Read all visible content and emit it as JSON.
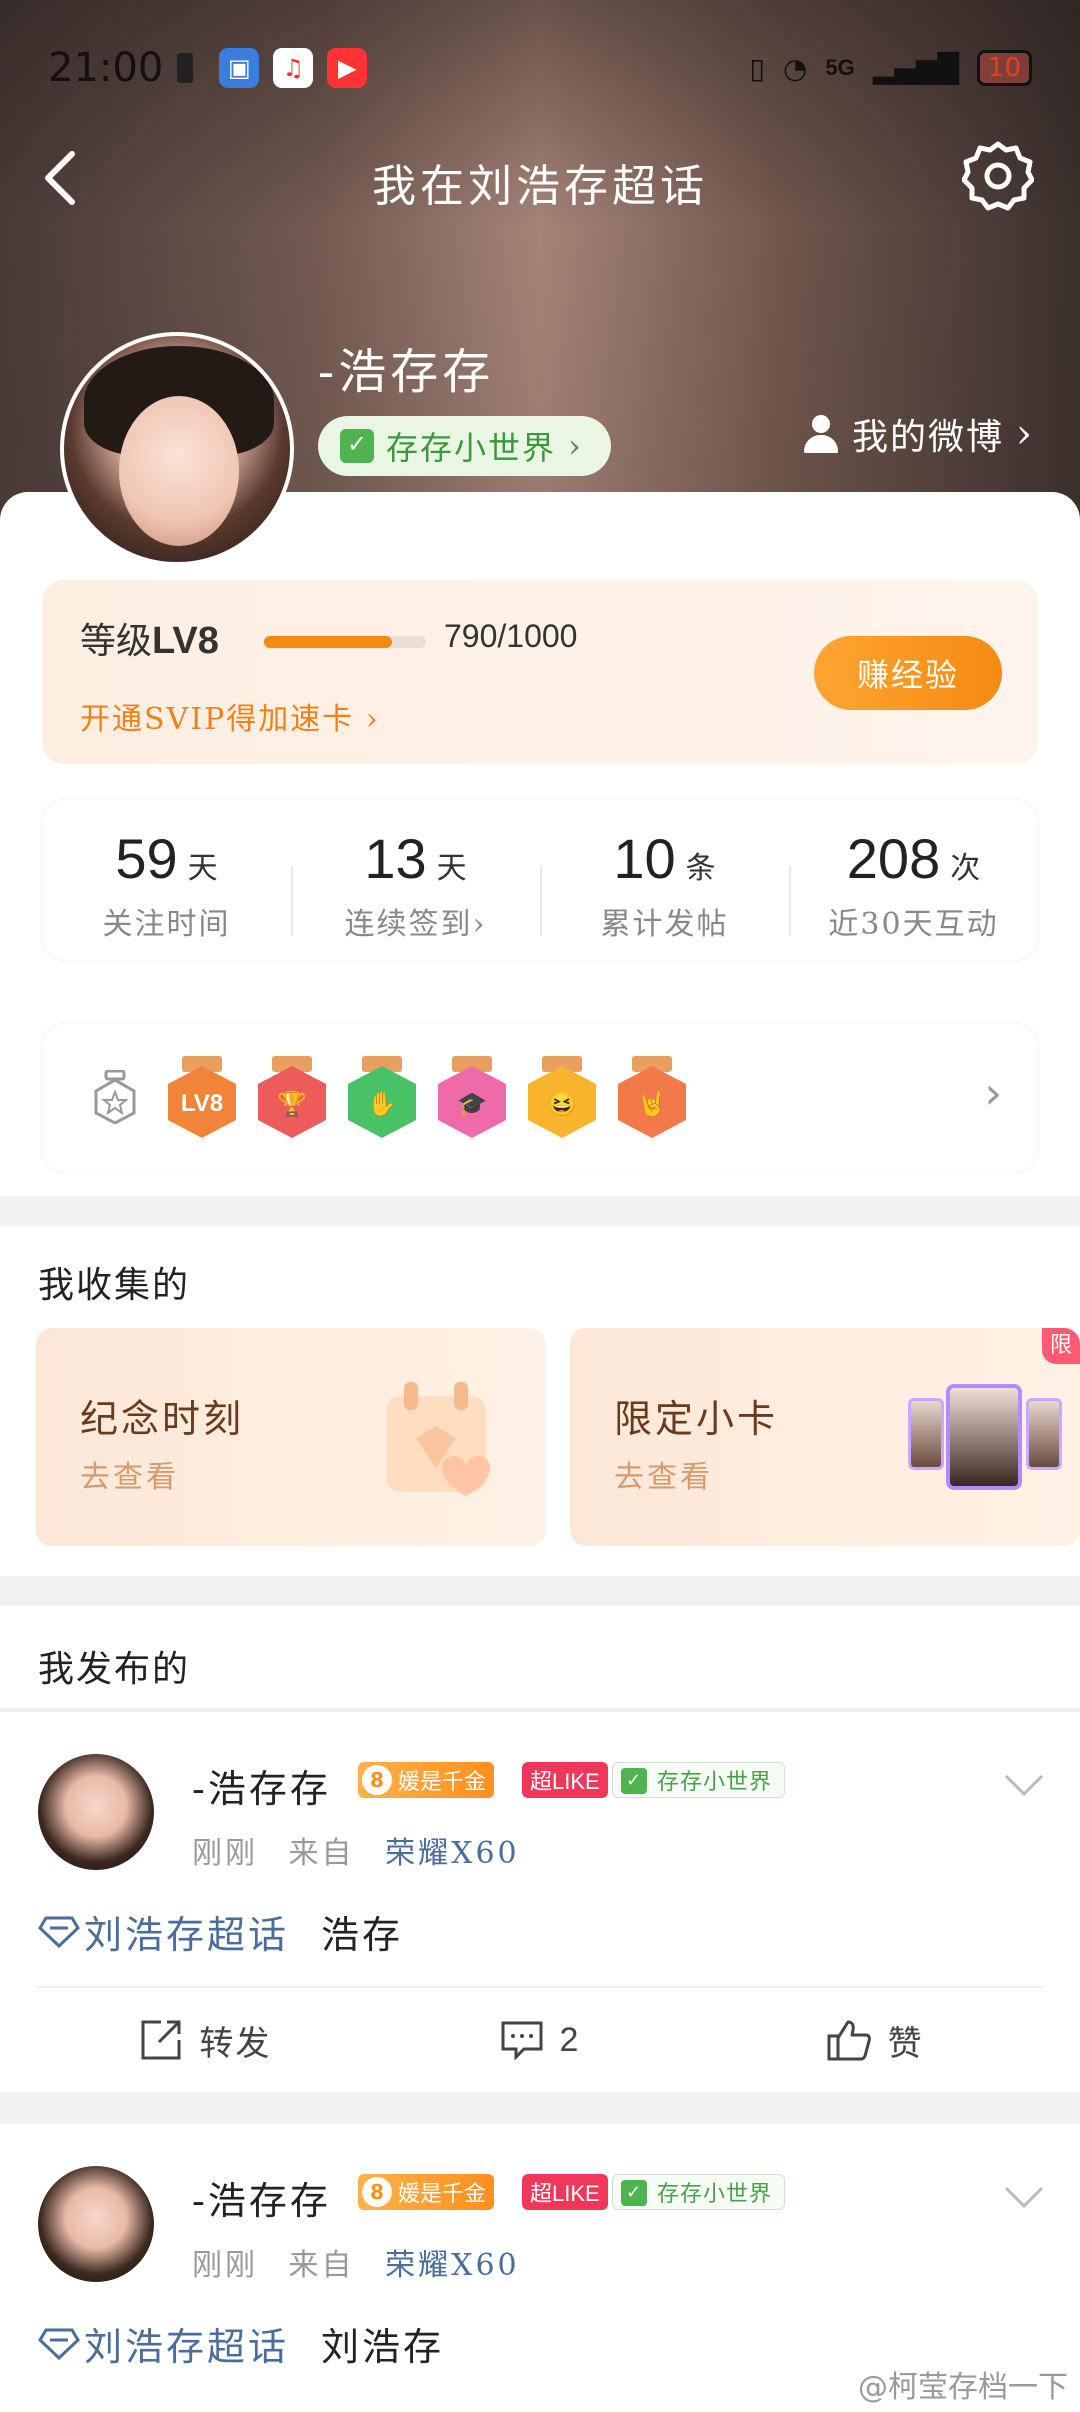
{
  "status_bar": {
    "time": "21:00",
    "battery": "10",
    "network": "5G"
  },
  "nav": {
    "title": "我在刘浩存超话"
  },
  "profile": {
    "username": "-浩存存",
    "world_pill": "存存小世界",
    "my_weibo": "我的微博"
  },
  "level": {
    "label_prefix": "等级",
    "level": "LV8",
    "progress_text": "790/1000",
    "progress": 0.79,
    "svip_text": "开通SVIP得加速卡",
    "earn_button": "赚经验"
  },
  "stats": [
    {
      "value": "59",
      "unit": "天",
      "label": "关注时间"
    },
    {
      "value": "13",
      "unit": "天",
      "label": "连续签到"
    },
    {
      "value": "10",
      "unit": "条",
      "label": "累计发帖"
    },
    {
      "value": "208",
      "unit": "次",
      "label": "近30天互动"
    }
  ],
  "badges": [
    {
      "name": "lv8-badge",
      "symbol": "LV8",
      "color": "#f2843a"
    },
    {
      "name": "trophy-badge",
      "symbol": "🏆",
      "color": "#ee5b5b"
    },
    {
      "name": "hand-badge",
      "symbol": "✋",
      "color": "#49c267"
    },
    {
      "name": "cap-badge",
      "symbol": "🎓",
      "color": "#ee6aa8"
    },
    {
      "name": "emoji-badge",
      "symbol": "😆",
      "color": "#f7b42c"
    },
    {
      "name": "rock-badge",
      "symbol": "🤘",
      "color": "#f27a4a"
    }
  ],
  "collection": {
    "title": "我收集的",
    "cards": [
      {
        "title": "纪念时刻",
        "sub": "去查看"
      },
      {
        "title": "限定小卡",
        "sub": "去查看",
        "tag": "限"
      }
    ]
  },
  "published": {
    "title": "我发布的"
  },
  "posts": [
    {
      "name": "-浩存存",
      "gold_tag": "媛是千金",
      "gold_level": "8",
      "like_tag": "超LIKE",
      "world_tag": "存存小世界",
      "time": "刚刚",
      "from": "来自",
      "device": "荣耀X60",
      "topic": "刘浩存超话",
      "text": "浩存",
      "actions": {
        "repost": "转发",
        "comment": "2",
        "like": "赞"
      }
    },
    {
      "name": "-浩存存",
      "gold_tag": "媛是千金",
      "gold_level": "8",
      "like_tag": "超LIKE",
      "world_tag": "存存小世界",
      "time": "刚刚",
      "from": "来自",
      "device": "荣耀X60",
      "topic": "刘浩存超话",
      "text": "刘浩存"
    }
  ],
  "watermark": "@柯莹存档一下"
}
